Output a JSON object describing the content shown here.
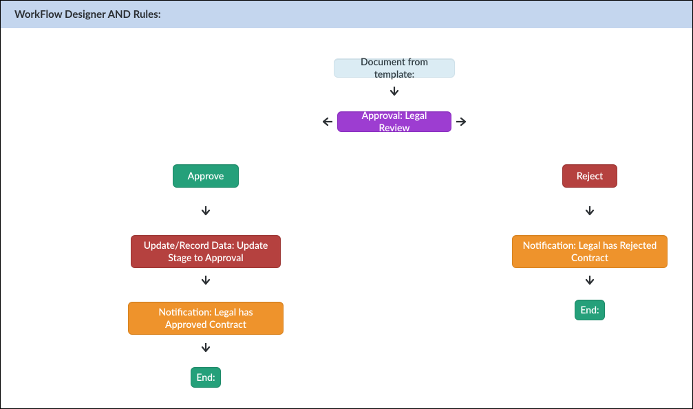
{
  "header": {
    "title": "WorkFlow Designer AND Rules:"
  },
  "nodes": {
    "start": "Document from template:",
    "approval": "Approval: Legal Review",
    "approve": "Approve",
    "reject": "Reject",
    "update_stage": "Update/Record Data: Update Stage to Approval",
    "notif_approved": "Notification: Legal has Approved Contract",
    "notif_rejected": "Notification: Legal has Rejected Contract",
    "end_left": "End:",
    "end_right": "End:"
  }
}
